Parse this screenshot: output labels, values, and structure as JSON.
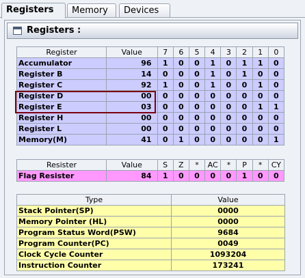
{
  "tabs": [
    "Registers",
    "Memory",
    "Devices"
  ],
  "panel_title": "Registers :",
  "registers_table": {
    "headers": [
      "Register",
      "Value",
      "7",
      "6",
      "5",
      "4",
      "3",
      "2",
      "1",
      "0"
    ],
    "rows": [
      {
        "name": "Accumulator",
        "value": "96",
        "bits": [
          "1",
          "0",
          "0",
          "1",
          "0",
          "1",
          "1",
          "0"
        ]
      },
      {
        "name": "Register B",
        "value": "14",
        "bits": [
          "0",
          "0",
          "0",
          "1",
          "0",
          "1",
          "0",
          "0"
        ]
      },
      {
        "name": "Register C",
        "value": "92",
        "bits": [
          "1",
          "0",
          "0",
          "1",
          "0",
          "0",
          "1",
          "0"
        ]
      },
      {
        "name": "Register D",
        "value": "00",
        "bits": [
          "0",
          "0",
          "0",
          "0",
          "0",
          "0",
          "0",
          "0"
        ]
      },
      {
        "name": "Register E",
        "value": "03",
        "bits": [
          "0",
          "0",
          "0",
          "0",
          "0",
          "0",
          "1",
          "1"
        ]
      },
      {
        "name": "Register H",
        "value": "00",
        "bits": [
          "0",
          "0",
          "0",
          "0",
          "0",
          "0",
          "0",
          "0"
        ]
      },
      {
        "name": "Register L",
        "value": "00",
        "bits": [
          "0",
          "0",
          "0",
          "0",
          "0",
          "0",
          "0",
          "0"
        ]
      },
      {
        "name": "Memory(M)",
        "value": "41",
        "bits": [
          "0",
          "1",
          "0",
          "0",
          "0",
          "0",
          "0",
          "1"
        ]
      }
    ]
  },
  "flag_table": {
    "headers": [
      "Resister",
      "Value",
      "S",
      "Z",
      "*",
      "AC",
      "*",
      "P",
      "*",
      "CY"
    ],
    "row": {
      "name": "Flag Resister",
      "value": "84",
      "bits": [
        "1",
        "0",
        "0",
        "0",
        "0",
        "1",
        "0",
        "0"
      ]
    }
  },
  "info_table": {
    "headers": [
      "Type",
      "Value"
    ],
    "rows": [
      {
        "type": "Stack Pointer(SP)",
        "value": "0000"
      },
      {
        "type": "Memory Pointer (HL)",
        "value": "0000"
      },
      {
        "type": "Program Status Word(PSW)",
        "value": "9684"
      },
      {
        "type": "Program Counter(PC)",
        "value": "0049"
      },
      {
        "type": "Clock Cycle Counter",
        "value": "1093204"
      },
      {
        "type": "Instruction Counter",
        "value": "173241"
      }
    ]
  },
  "colors": {
    "register_row_bg": "#ccccff",
    "flag_row_bg": "#ff99ff",
    "info_row_bg": "#ffffaa",
    "highlight_border": "#7a0010"
  }
}
